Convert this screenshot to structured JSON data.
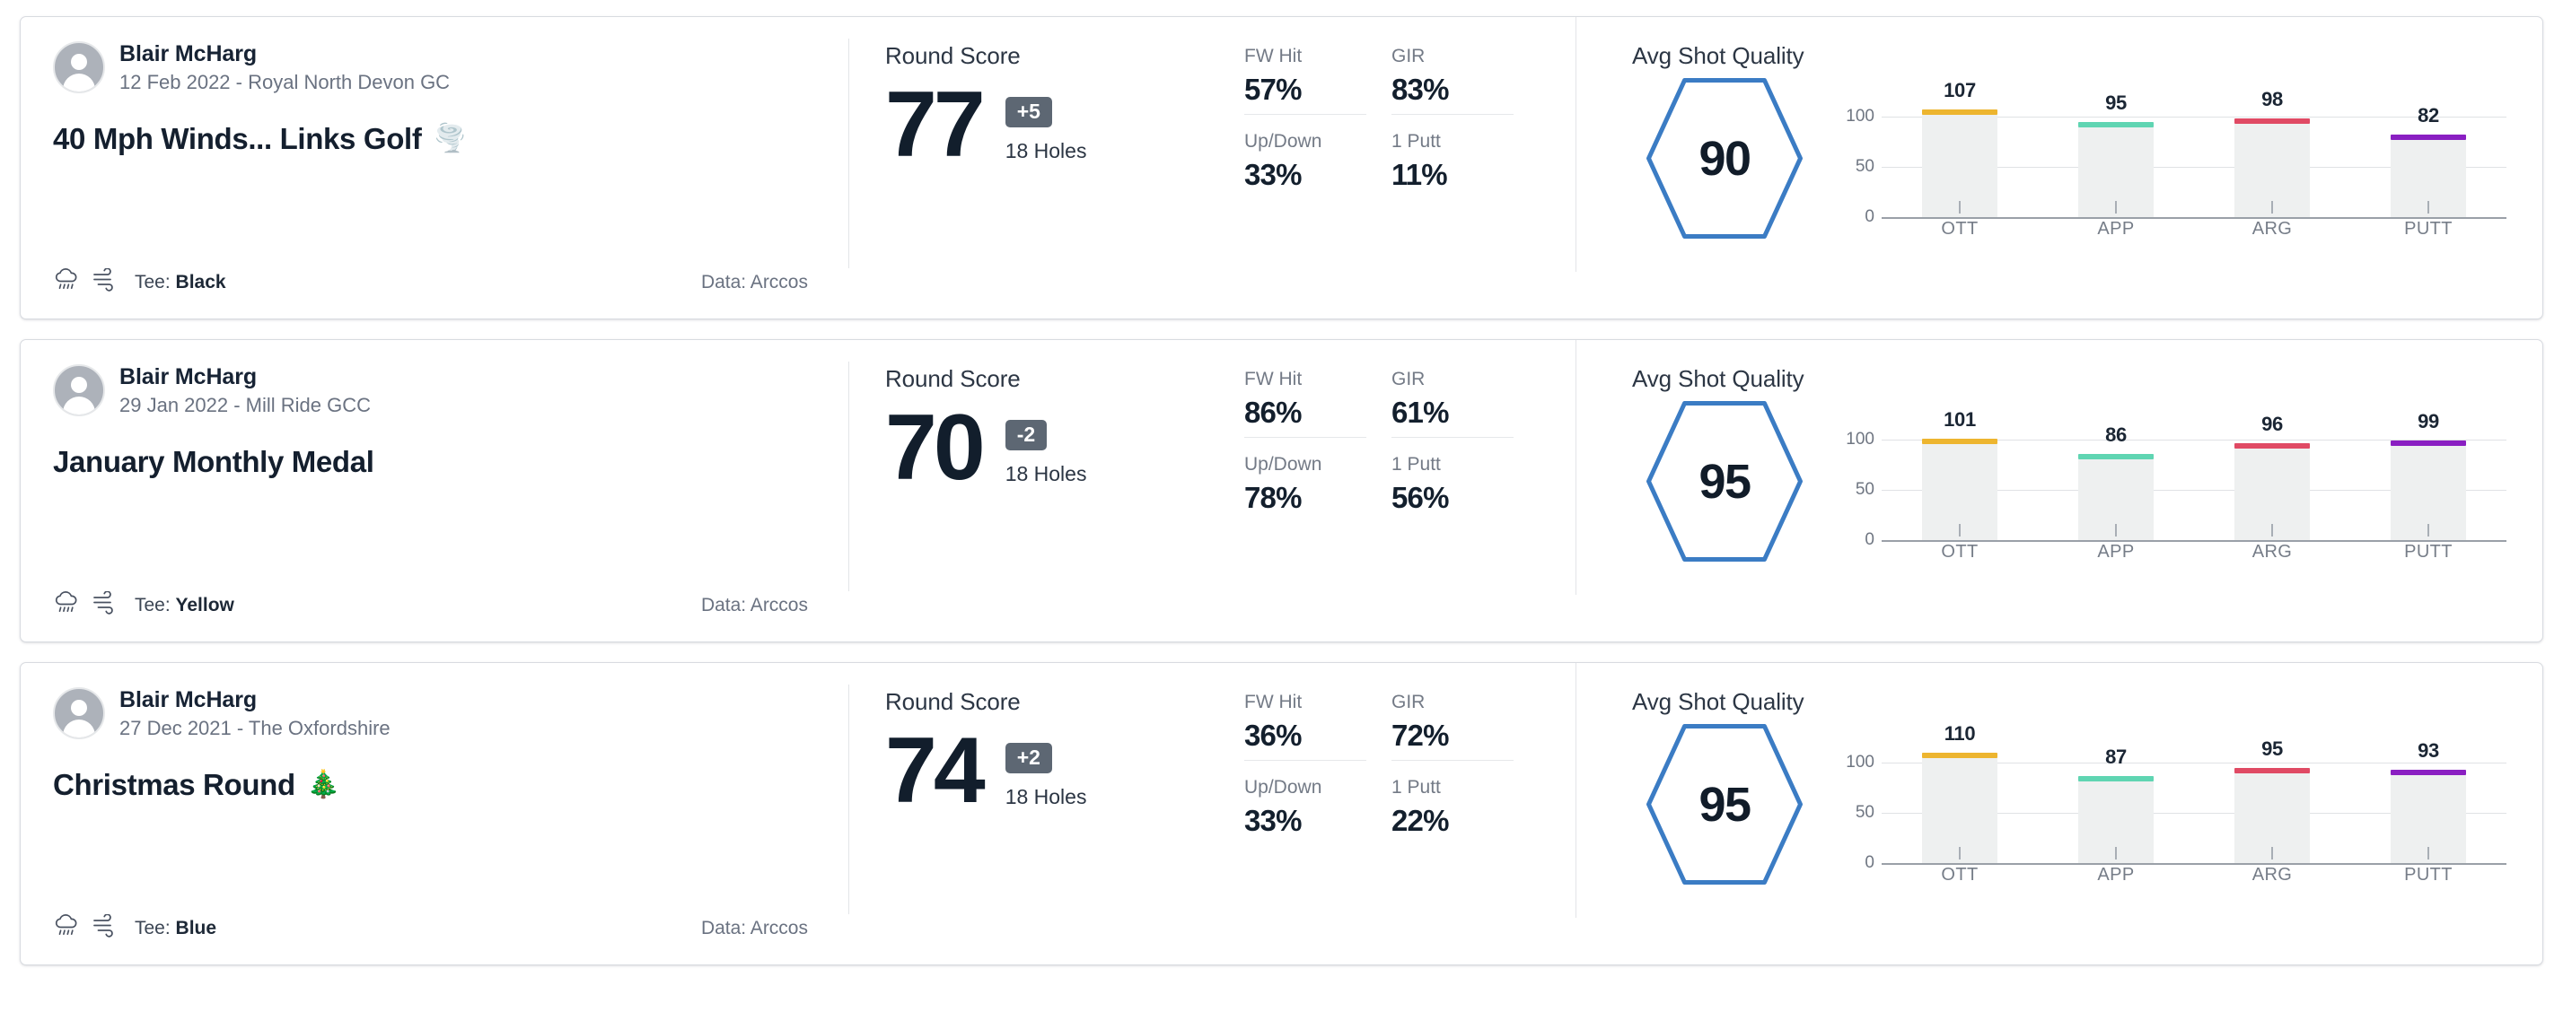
{
  "common": {
    "round_score_label": "Round Score",
    "holes_label": "18 Holes",
    "avg_shot_quality_label": "Avg Shot Quality",
    "tee_prefix": "Tee: ",
    "data_source_label": "Data: Arccos",
    "stat_labels": {
      "fw_hit": "FW Hit",
      "gir": "GIR",
      "up_down": "Up/Down",
      "one_putt": "1 Putt"
    },
    "icons": {
      "avatar": "avatar-person-icon",
      "weather": "rain-cloud-icon",
      "wind": "wind-icon"
    },
    "colors": {
      "hexagon_stroke": "#3B7CC4",
      "to_par_badge": "#5D6773",
      "bar_fill": "#EEF0F0",
      "ott": "#EDB52F",
      "app": "#5FD5B2",
      "arg": "#E04A64",
      "putt": "#8A1FC2"
    },
    "chart_axis": {
      "ylabels": [
        "100",
        "50",
        "0"
      ],
      "ymax": 125,
      "categories": [
        "OTT",
        "APP",
        "ARG",
        "PUTT"
      ]
    }
  },
  "rounds": [
    {
      "player": "Blair McHarg",
      "meta": "12 Feb 2022 - Royal North Devon GC",
      "title": "40 Mph Winds... Links Golf",
      "title_emoji": "🌪️",
      "tee": "Black",
      "score": "77",
      "to_par": "+5",
      "holes": "18 Holes",
      "stats": {
        "fw_hit": "57%",
        "gir": "83%",
        "up_down": "33%",
        "one_putt": "11%"
      },
      "shot_quality": "90",
      "chart_data": {
        "type": "bar",
        "title": "Avg Shot Quality",
        "categories": [
          "OTT",
          "APP",
          "ARG",
          "PUTT"
        ],
        "values": [
          107,
          95,
          98,
          82
        ],
        "ylim": [
          0,
          125
        ],
        "yticks": [
          0,
          50,
          100
        ],
        "xlabel": "",
        "ylabel": "",
        "grid": true,
        "legend": "none",
        "series_colors": [
          "#EDB52F",
          "#5FD5B2",
          "#E04A64",
          "#8A1FC2"
        ]
      }
    },
    {
      "player": "Blair McHarg",
      "meta": "29 Jan 2022 - Mill Ride GCC",
      "title": "January Monthly Medal",
      "title_emoji": "",
      "tee": "Yellow",
      "score": "70",
      "to_par": "-2",
      "holes": "18 Holes",
      "stats": {
        "fw_hit": "86%",
        "gir": "61%",
        "up_down": "78%",
        "one_putt": "56%"
      },
      "shot_quality": "95",
      "chart_data": {
        "type": "bar",
        "title": "Avg Shot Quality",
        "categories": [
          "OTT",
          "APP",
          "ARG",
          "PUTT"
        ],
        "values": [
          101,
          86,
          96,
          99
        ],
        "ylim": [
          0,
          125
        ],
        "yticks": [
          0,
          50,
          100
        ],
        "xlabel": "",
        "ylabel": "",
        "grid": true,
        "legend": "none",
        "series_colors": [
          "#EDB52F",
          "#5FD5B2",
          "#E04A64",
          "#8A1FC2"
        ]
      }
    },
    {
      "player": "Blair McHarg",
      "meta": "27 Dec 2021 - The Oxfordshire",
      "title": "Christmas Round",
      "title_emoji": "🎄",
      "tee": "Blue",
      "score": "74",
      "to_par": "+2",
      "holes": "18 Holes",
      "stats": {
        "fw_hit": "36%",
        "gir": "72%",
        "up_down": "33%",
        "one_putt": "22%"
      },
      "shot_quality": "95",
      "chart_data": {
        "type": "bar",
        "title": "Avg Shot Quality",
        "categories": [
          "OTT",
          "APP",
          "ARG",
          "PUTT"
        ],
        "values": [
          110,
          87,
          95,
          93
        ],
        "ylim": [
          0,
          125
        ],
        "yticks": [
          0,
          50,
          100
        ],
        "xlabel": "",
        "ylabel": "",
        "grid": true,
        "legend": "none",
        "series_colors": [
          "#EDB52F",
          "#5FD5B2",
          "#E04A64",
          "#8A1FC2"
        ]
      }
    }
  ]
}
